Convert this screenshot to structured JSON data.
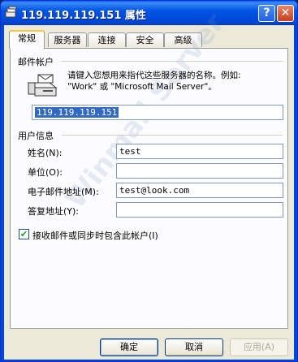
{
  "window": {
    "title": "119.119.119.151 属性",
    "help_label": "?",
    "close_label": "✕"
  },
  "tabs": [
    {
      "label": "常规",
      "active": true
    },
    {
      "label": "服务器",
      "active": false
    },
    {
      "label": "连接",
      "active": false
    },
    {
      "label": "安全",
      "active": false
    },
    {
      "label": "高级",
      "active": false
    }
  ],
  "mail_account": {
    "group_label": "邮件帐户",
    "description_line1": "请键入您想用来指代这些服务器的名称。例如:",
    "description_line2": "\"Work\" 或 \"Microsoft Mail Server\"。",
    "account_name_value": "119.119.119.151"
  },
  "user_info": {
    "group_label": "用户信息",
    "name_label": "姓名(N):",
    "name_value": "test",
    "company_label": "单位(O):",
    "company_value": "",
    "email_label": "电子邮件地址(M):",
    "email_value": "test@look.com",
    "reply_label": "答复地址(Y):",
    "reply_value": ""
  },
  "include_checkbox": {
    "label": "接收邮件或同步时包含此帐户(I)",
    "checked": true
  },
  "buttons": {
    "ok": "确定",
    "cancel": "取消",
    "apply": "应用(A)"
  },
  "watermark": "Winmail Server",
  "colors": {
    "title_bar": "#0055e5",
    "selection": "#316ac5",
    "active_tab_accent": "#ffc83c"
  }
}
